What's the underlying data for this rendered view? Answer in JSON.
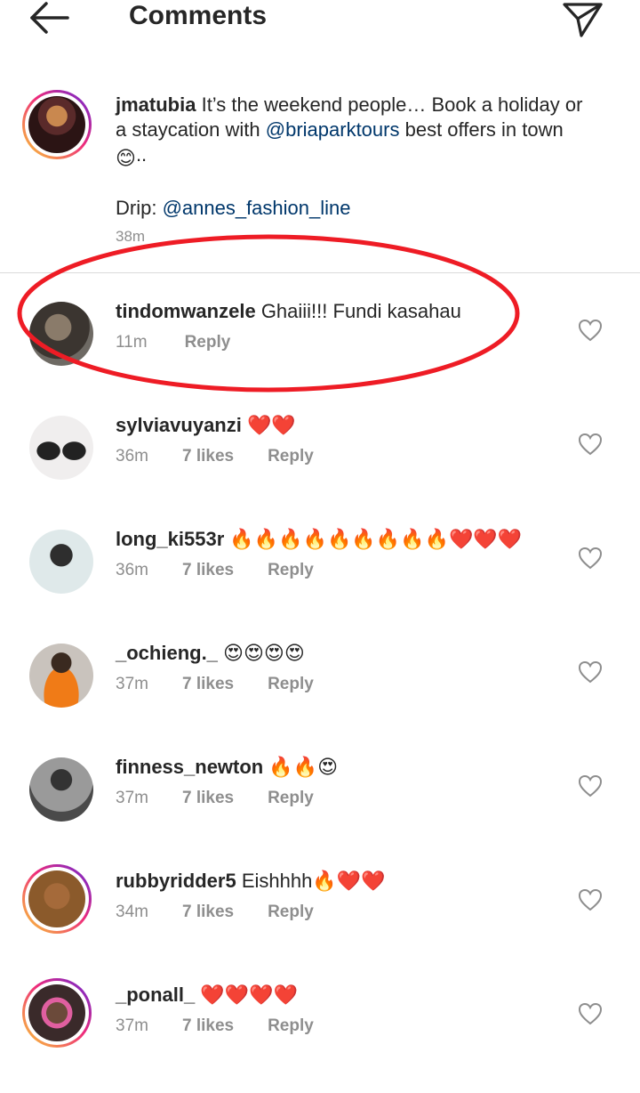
{
  "header": {
    "title": "Comments",
    "back_icon": "back-arrow-icon",
    "share_icon": "paper-plane-icon"
  },
  "caption": {
    "username": "jmatubia",
    "text_part1": " It’s the weekend people… Book a holiday or a staycation with ",
    "mention1": "@briaparktours",
    "text_part2": " best offers in town ",
    "emoji": "😊",
    "text_part3": "..",
    "drip_label": "Drip: ",
    "mention2": "@annes_fashion_line",
    "time": "38m"
  },
  "comments": [
    {
      "username": "tindomwanzele",
      "text": "Ghaiii!!! Fundi kasahau",
      "time": "11m",
      "likes": "",
      "reply": "Reply"
    },
    {
      "username": "sylviavuyanzi",
      "text": "❤️❤️",
      "time": "36m",
      "likes": "7 likes",
      "reply": "Reply"
    },
    {
      "username": "long_ki553r",
      "text": "🔥🔥🔥🔥🔥🔥🔥🔥🔥❤️❤️❤️",
      "time": "36m",
      "likes": "7 likes",
      "reply": "Reply"
    },
    {
      "username": "_ochieng._",
      "text": "😍😍😍😍",
      "time": "37m",
      "likes": "7 likes",
      "reply": "Reply"
    },
    {
      "username": "finness_newton",
      "text": "🔥🔥😍",
      "time": "37m",
      "likes": "7 likes",
      "reply": "Reply"
    },
    {
      "username": "rubbyridder5",
      "text": "Eishhhh🔥❤️❤️",
      "time": "34m",
      "likes": "7 likes",
      "reply": "Reply"
    },
    {
      "username": "_ponall_",
      "text": "❤️❤️❤️❤️",
      "time": "37m",
      "likes": "7 likes",
      "reply": "Reply"
    }
  ],
  "colors": {
    "text": "#262626",
    "muted": "#8e8e8e",
    "mention": "#00376b",
    "highlight": "#ee1c25"
  }
}
